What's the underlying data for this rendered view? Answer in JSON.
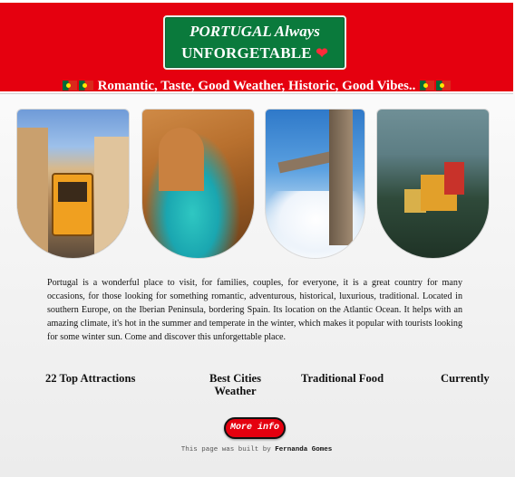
{
  "header": {
    "title_line1": "PORTUGAL Always",
    "title_line2": "UNFORGETABLE",
    "heart_icon": "heart-icon",
    "tagline": "Romantic, Taste, Good Weather, Historic, Good Vibes..",
    "flag_icon": "portugal-flag-icon"
  },
  "colors": {
    "header_red": "#e5000f",
    "title_green": "#0a7a3c",
    "button_red": "#e5000f"
  },
  "gallery": [
    {
      "subject": "Lisbon tram street"
    },
    {
      "subject": "Algarve coastline"
    },
    {
      "subject": "Christ the King statue"
    },
    {
      "subject": "Pena Palace"
    }
  ],
  "intro": "Portugal is a wonderful place to visit, for families, couples, for everyone, it is a great country for many occasions, for those looking for something romantic, adventurous, historical, luxurious, traditional. Located in southern Europe, on the Iberian Peninsula, bordering Spain. Its location on the Atlantic Ocean. It helps with an amazing climate, it's hot in the summer and temperate in the winter, which makes it popular with tourists looking for some winter sun. Come and discover this unforgettable place.",
  "nav": {
    "attractions": "22 Top Attractions",
    "cities": "Best Cities",
    "food": "Traditional Food",
    "weather_line1": "Currently",
    "weather_line2": "Weather"
  },
  "button": {
    "more_info": "More info"
  },
  "footer": {
    "prefix": "This page was built by",
    "author": "Fernanda Gomes"
  }
}
